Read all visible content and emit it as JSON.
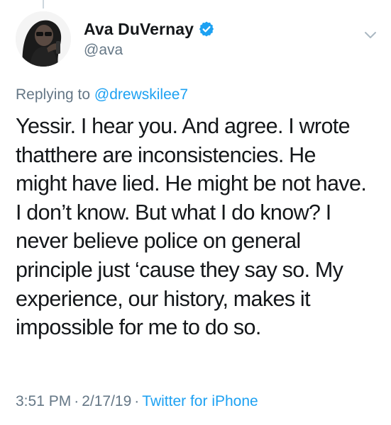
{
  "tweet": {
    "display_name": "Ava DuVernay",
    "handle": "@ava",
    "replying_prefix": "Replying to",
    "replying_to": "@drewskilee7",
    "text_lines": [
      "Yessir. I hear you. And agree. I wrote",
      "thatthere are inconsistencies. He",
      "might have lied. He might be not have.",
      "I don’t know. But what I do know? I",
      "never believe police on general",
      "principle just ‘cause they say so. My",
      "experience, our history, makes it",
      "impossible for me to do so."
    ],
    "time": "3:51 PM",
    "separator": "·",
    "date": "2/17/19",
    "source": "Twitter for iPhone"
  },
  "colors": {
    "text": "#14171a",
    "secondary": "#657786",
    "link": "#1da1f2",
    "verified": "#1da1f2"
  },
  "icons": {
    "verified": "verified-badge-icon",
    "menu": "chevron-down-icon"
  }
}
